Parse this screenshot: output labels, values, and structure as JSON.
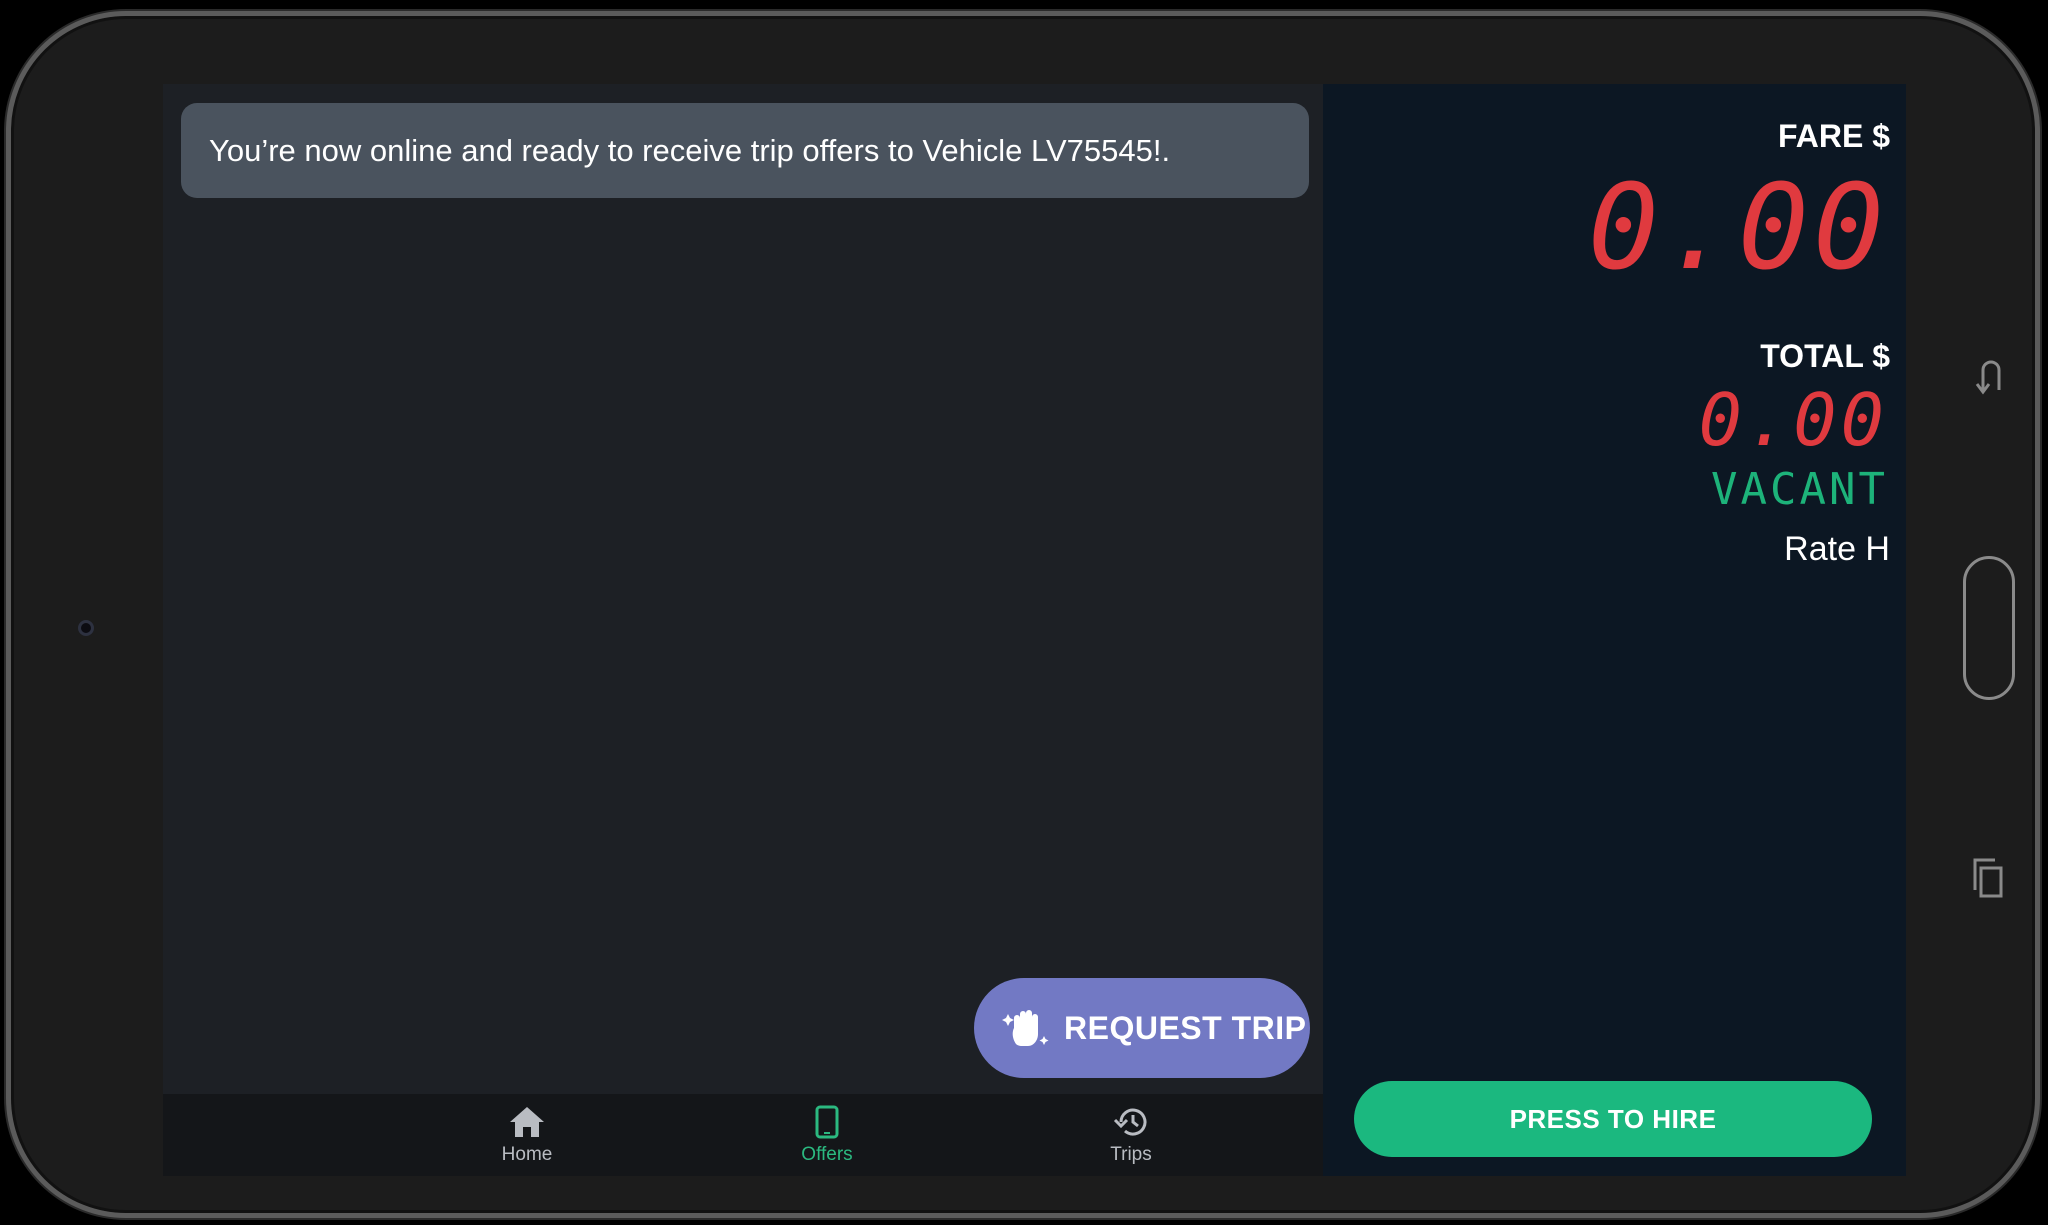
{
  "notice": {
    "text": "You’re now online and ready to receive trip offers to Vehicle LV75545!."
  },
  "request_button": {
    "label": "REQUEST TRIP",
    "icon": "hand-sparkle-icon"
  },
  "bottom_nav": {
    "items": [
      {
        "label": "Home",
        "icon": "home-icon",
        "active": false
      },
      {
        "label": "Offers",
        "icon": "phone-icon",
        "active": true
      },
      {
        "label": "Trips",
        "icon": "history-icon",
        "active": false
      }
    ]
  },
  "meter": {
    "fare_label": "FARE $",
    "fare_value": "0.00",
    "total_label": "TOTAL $",
    "total_value": "0.00",
    "status": "VACANT",
    "rate": "Rate H"
  },
  "hire_button": {
    "label": "PRESS TO HIRE"
  },
  "colors": {
    "accent_green": "#1bb87f",
    "meter_red": "#e03a3f",
    "request_purple": "#7279c4"
  }
}
